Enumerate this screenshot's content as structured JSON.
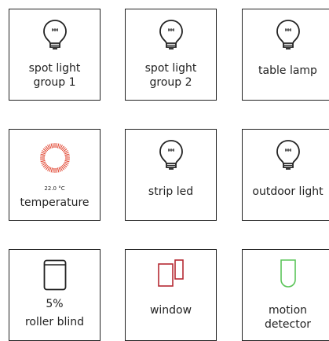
{
  "tiles": [
    {
      "label": "spot light\ngroup 1",
      "icon": "bulb-icon"
    },
    {
      "label": "spot light\ngroup 2",
      "icon": "bulb-icon"
    },
    {
      "label": "table lamp",
      "icon": "bulb-icon"
    },
    {
      "label": "temperature",
      "value": "22.0 °C",
      "icon": "thermostat-icon"
    },
    {
      "label": "strip led",
      "icon": "bulb-icon"
    },
    {
      "label": "outdoor light",
      "icon": "bulb-icon"
    },
    {
      "label": "roller blind",
      "value": "5%",
      "icon": "roller-blind-icon"
    },
    {
      "label": "window",
      "icon": "window-sensor-icon"
    },
    {
      "label": "motion\ndetector",
      "icon": "motion-sensor-icon"
    }
  ],
  "colors": {
    "border": "#222222",
    "temperature_ring": "#e0412c",
    "window_icon": "#b52a33",
    "motion_icon": "#5cc55a"
  }
}
